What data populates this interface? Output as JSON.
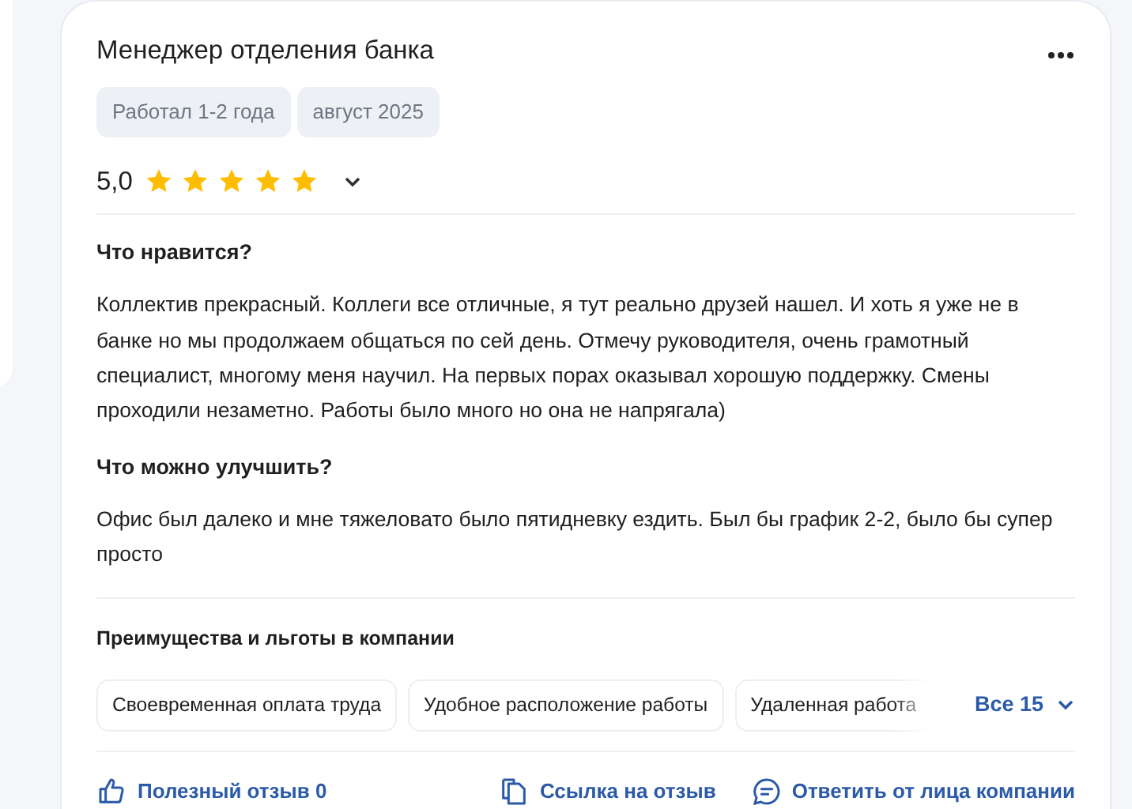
{
  "review": {
    "title": "Менеджер отделения банка",
    "tags": [
      "Работал 1-2 года",
      "август 2025"
    ],
    "rating": "5,0",
    "stars": 5,
    "sections": [
      {
        "heading": "Что нравится?",
        "text": "Коллектив прекрасный. Коллеги все отличные, я тут реально друзей нашел. И хоть я уже не в банке но мы продолжаем общаться по сей день. Отмечу руководителя, очень грамотный специалист, многому меня научил. На первых порах оказывал хорошую поддержку. Смены проходили незаметно. Работы было много но она не напрягала)"
      },
      {
        "heading": "Что можно улучшить?",
        "text": "Офис был далеко и мне тяжеловато было пятидневку ездить. Был бы график 2-2, было бы супер просто"
      }
    ],
    "benefits": {
      "heading": "Преимущества и льготы в компании",
      "items": [
        "Своевременная оплата труда",
        "Удобное расположение работы",
        "Удаленная работа"
      ],
      "more": "Все 15"
    },
    "actions": [
      {
        "kind": "like",
        "label": "Полезный отзыв 0"
      },
      {
        "kind": "link",
        "label": "Ссылка на отзыв"
      },
      {
        "kind": "reply",
        "label": "Ответить от лица компании"
      }
    ]
  }
}
